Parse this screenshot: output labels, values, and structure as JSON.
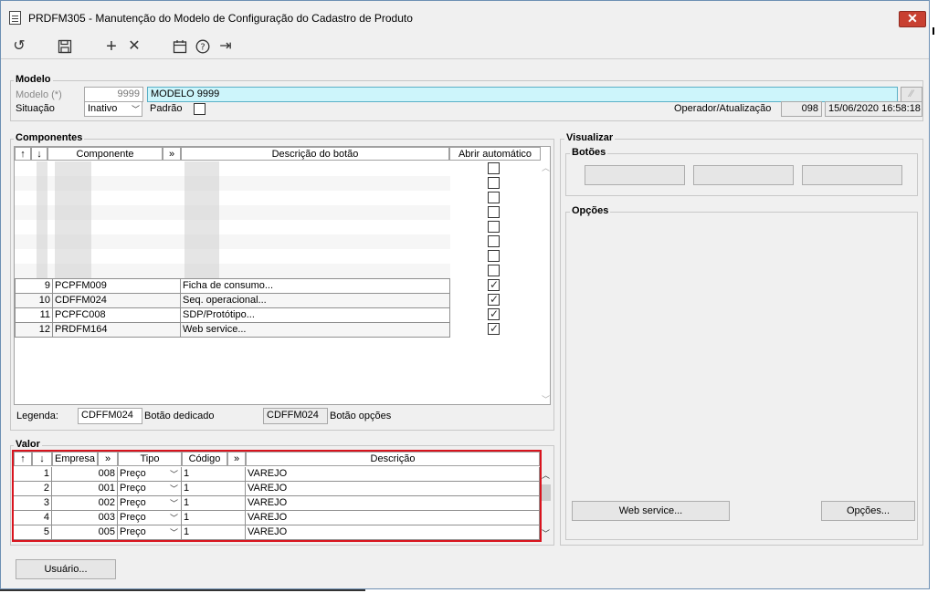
{
  "window": {
    "title": "PRDFM305 - Manutenção do Modelo de Configuração do Cadastro de Produto",
    "close_glyph": "✕"
  },
  "toolbar": {
    "icons": [
      "undo-icon",
      "save-icon",
      "add-icon",
      "delete-icon",
      "calendar-icon",
      "help-icon",
      "exit-icon"
    ],
    "glyphs": {
      "undo": "↺",
      "save": "💾",
      "add": "+",
      "delete": "✕",
      "calendar": "🗓",
      "help": "?",
      "exit": "⇥"
    }
  },
  "modelo": {
    "group_label": "Modelo",
    "modelo_label": "Modelo (*)",
    "modelo_code": "9999",
    "modelo_name": "MODELO 9999",
    "situacao_label": "Situação",
    "situacao_value": "Inativo",
    "padrao_label": "Padrão",
    "operador_label": "Operador/Atualização",
    "operador_value": "098",
    "atualizacao_value": "15/06/2020 16:58:18"
  },
  "componentes": {
    "group_label": "Componentes",
    "headers": {
      "up": "↑",
      "down": "↓",
      "componente": "Componente",
      "expand": "»",
      "descricao": "Descrição do botão",
      "abrir": "Abrir automático"
    },
    "rows": [
      {
        "num": "9",
        "comp": "PCPFM009",
        "desc": "Ficha de consumo..."
      },
      {
        "num": "10",
        "comp": "CDFFM024",
        "desc": "Seq. operacional..."
      },
      {
        "num": "11",
        "comp": "PCPFC008",
        "desc": "SDP/Protótipo..."
      },
      {
        "num": "12",
        "comp": "PRDFM164",
        "desc": "Web service..."
      }
    ],
    "legenda_label": "Legenda:",
    "legenda_dedicado_value": "CDFFM024",
    "legenda_dedicado_label": "Botão dedicado",
    "legenda_opcoes_value": "CDFFM024",
    "legenda_opcoes_label": "Botão opções"
  },
  "visualizar": {
    "group_label": "Visualizar",
    "botoes_label": "Botões",
    "opcoes_label": "Opções",
    "webservice_button": "Web service...",
    "opcoes_button": "Opções..."
  },
  "valor": {
    "group_label": "Valor",
    "headers": {
      "up": "↑",
      "down": "↓",
      "empresa": "Empresa",
      "expand1": "»",
      "tipo": "Tipo",
      "codigo": "Código",
      "expand2": "»",
      "descricao": "Descrição"
    },
    "rows": [
      {
        "num": "1",
        "empresa": "008",
        "tipo": "Preço",
        "codigo": "1",
        "descricao": "VAREJO"
      },
      {
        "num": "2",
        "empresa": "001",
        "tipo": "Preço",
        "codigo": "1",
        "descricao": "VAREJO"
      },
      {
        "num": "3",
        "empresa": "002",
        "tipo": "Preço",
        "codigo": "1",
        "descricao": "VAREJO"
      },
      {
        "num": "4",
        "empresa": "003",
        "tipo": "Preço",
        "codigo": "1",
        "descricao": "VAREJO"
      },
      {
        "num": "5",
        "empresa": "005",
        "tipo": "Preço",
        "codigo": "1",
        "descricao": "VAREJO"
      }
    ],
    "dropdown_glyph": "﹀"
  },
  "usuario_button": "Usuário...",
  "colors": {
    "highlight_input": "#cdf5fb",
    "red_border": "#d9141e",
    "close_red": "#c84031"
  }
}
